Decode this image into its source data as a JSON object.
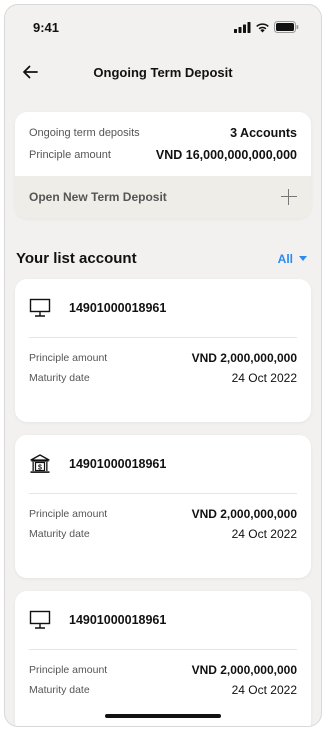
{
  "status_bar": {
    "time": "9:41"
  },
  "nav": {
    "title": "Ongoing Term Deposit"
  },
  "summary": {
    "deposits_label": "Ongoing term deposits",
    "deposits_value": "3 Accounts",
    "principle_label": "Principle amount",
    "principle_value": "VND 16,000,000,000,000",
    "open_label": "Open New Term Deposit"
  },
  "list": {
    "title": "Your list account",
    "filter": "All",
    "accounts": [
      {
        "icon": "computer-icon",
        "number": "14901000018961",
        "principle_label": "Principle amount",
        "principle_value": "VND 2,000,000,000",
        "maturity_label": "Maturity date",
        "maturity_value": "24 Oct 2022"
      },
      {
        "icon": "bank-icon",
        "number": "14901000018961",
        "principle_label": "Principle amount",
        "principle_value": "VND 2,000,000,000",
        "maturity_label": "Maturity date",
        "maturity_value": "24 Oct 2022"
      },
      {
        "icon": "computer-icon",
        "number": "14901000018961",
        "principle_label": "Principle amount",
        "principle_value": "VND 2,000,000,000",
        "maturity_label": "Maturity date",
        "maturity_value": "24 Oct 2022"
      }
    ]
  },
  "colors": {
    "accent": "#2b8bf0",
    "background": "#f2f1ef",
    "card": "#ffffff"
  }
}
